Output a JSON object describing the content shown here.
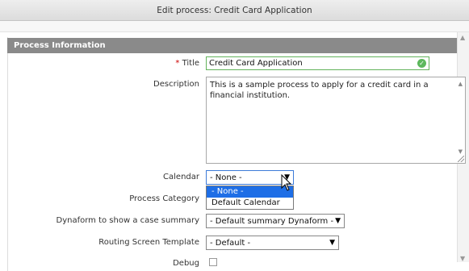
{
  "window": {
    "title": "Edit process: Credit Card Application"
  },
  "panel": {
    "header": "Process Information"
  },
  "form": {
    "title": {
      "required_mark": "*",
      "label": "Title",
      "value": "Credit Card Application"
    },
    "description": {
      "label": "Description",
      "value": "This is a sample process to apply for a credit card in a financial institution."
    },
    "calendar": {
      "label": "Calendar",
      "selected": "- None -",
      "options": [
        "- None -",
        "Default Calendar"
      ]
    },
    "process_category": {
      "label": "Process Category"
    },
    "dynaform_summary": {
      "label": "Dynaform to show a case summary",
      "selected": "- Default summary Dynaform -"
    },
    "routing_template": {
      "label": "Routing Screen Template",
      "selected": "- Default -"
    },
    "partial_label": "Debug"
  },
  "icons": {
    "valid": "check-circle-icon",
    "caret": "dropdown-arrow-icon",
    "cursor": "mouse-pointer-icon"
  },
  "colors": {
    "header_bg": "#8a8a8a",
    "valid": "#5cb85c",
    "selection": "#1e6ee6",
    "required": "#cc0000"
  }
}
